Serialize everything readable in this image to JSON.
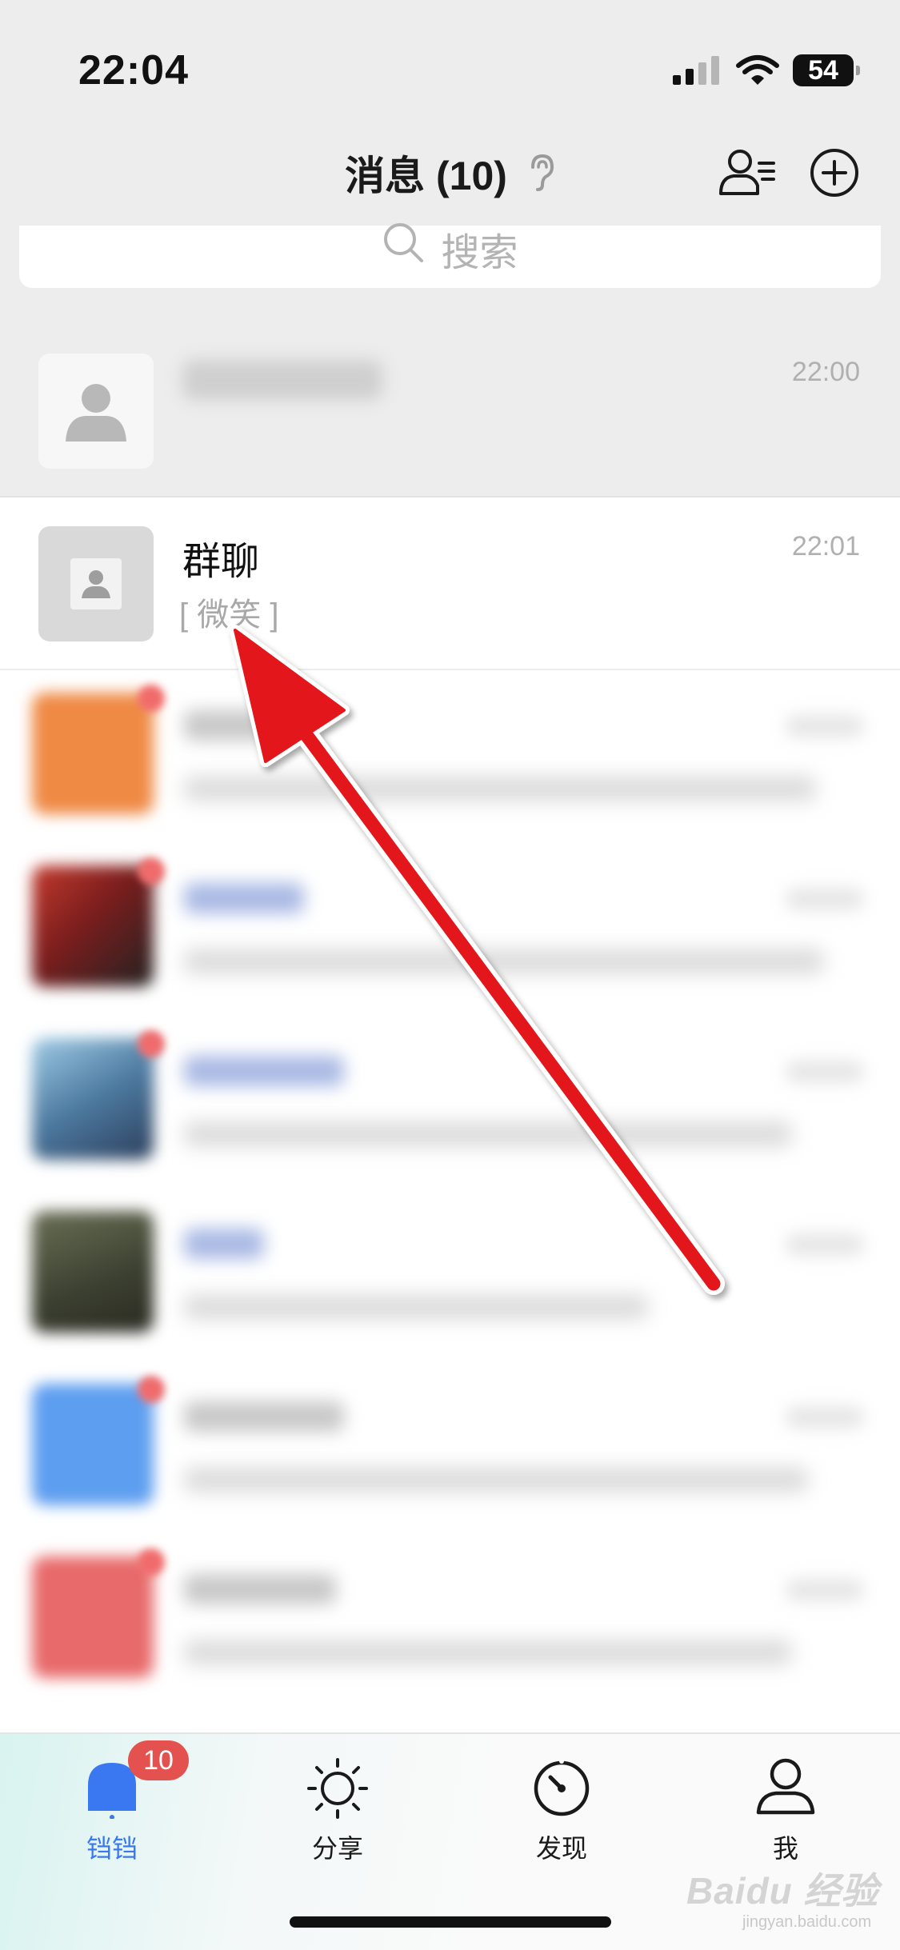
{
  "status_bar": {
    "time": "22:04",
    "battery": "54"
  },
  "header": {
    "title": "消息 (10)"
  },
  "search": {
    "placeholder": "搜索"
  },
  "chats": [
    {
      "name": "",
      "time": "22:00",
      "pinned": true
    },
    {
      "name": "群聊",
      "preview": "[ 微笑 ]",
      "time": "22:01"
    }
  ],
  "tabs": [
    {
      "label": "铛铛",
      "active": true,
      "badge": "10"
    },
    {
      "label": "分享"
    },
    {
      "label": "发现"
    },
    {
      "label": "我"
    }
  ],
  "colors": {
    "accent": "#3a78f2",
    "badge": "#e4524f",
    "arrow": "#e3151b",
    "header_bg": "#ededed"
  },
  "watermark": {
    "logo": "Baidu 经验",
    "url": "jingyan.baidu.com"
  }
}
